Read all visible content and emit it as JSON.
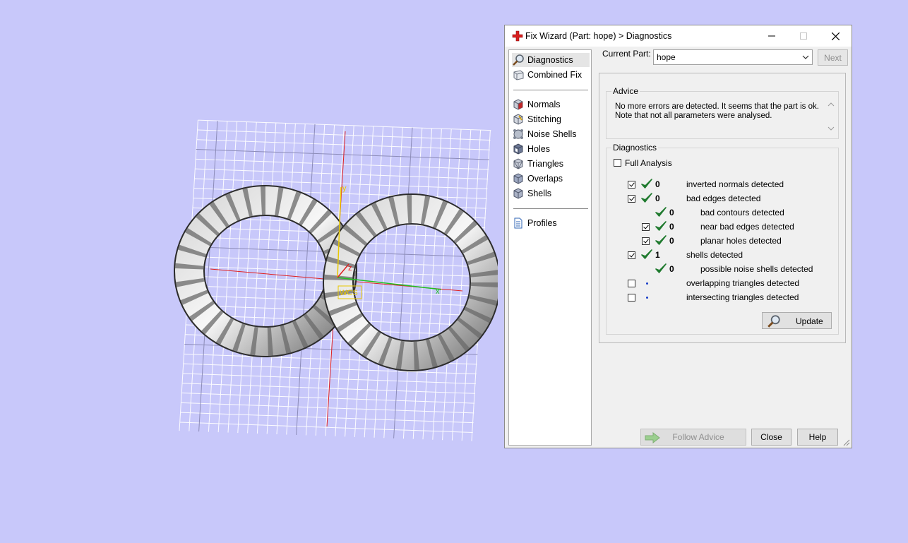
{
  "viewport": {
    "axis_labels": {
      "x": "x",
      "y": "y",
      "z": "z"
    },
    "wcs_label": "WCS"
  },
  "window": {
    "title": "Fix Wizard (Part: hope) > Diagnostics",
    "controls": {
      "minimize": "minimize",
      "maximize": "maximize",
      "close": "close"
    }
  },
  "nav": {
    "items": [
      {
        "label": "Diagnostics",
        "icon": "magnifier-icon",
        "selected": true
      },
      {
        "label": "Combined Fix",
        "icon": "combined-fix-icon"
      },
      {
        "label": "Normals",
        "icon": "normals-cube-icon"
      },
      {
        "label": "Stitching",
        "icon": "stitching-cube-icon"
      },
      {
        "label": "Noise Shells",
        "icon": "noise-shells-icon"
      },
      {
        "label": "Holes",
        "icon": "holes-cube-icon"
      },
      {
        "label": "Triangles",
        "icon": "triangles-cube-icon"
      },
      {
        "label": "Overlaps",
        "icon": "overlaps-cube-icon"
      },
      {
        "label": "Shells",
        "icon": "shells-cube-icon"
      },
      {
        "label": "Profiles",
        "icon": "profiles-document-icon"
      }
    ]
  },
  "toolbar": {
    "current_part_label": "Current Part:",
    "current_part_value": "hope",
    "next_label": "Next"
  },
  "advice": {
    "title": "Advice",
    "line1": "No more errors are detected. It seems that the part is ok.",
    "line2": "Note that not all parameters were analysed."
  },
  "diagnostics": {
    "title": "Diagnostics",
    "full_analysis_label": "Full Analysis",
    "full_analysis_checked": false,
    "rows": [
      {
        "checkbox": true,
        "checked": true,
        "status": "ok",
        "count": "0",
        "label": "inverted normals detected",
        "indent": 0
      },
      {
        "checkbox": true,
        "checked": true,
        "status": "ok",
        "count": "0",
        "label": "bad edges detected",
        "indent": 0
      },
      {
        "checkbox": false,
        "checked": false,
        "status": "ok",
        "count": "0",
        "label": "bad contours detected",
        "indent": 1
      },
      {
        "checkbox": true,
        "checked": true,
        "status": "ok",
        "count": "0",
        "label": "near bad edges detected",
        "indent": 1
      },
      {
        "checkbox": true,
        "checked": true,
        "status": "ok",
        "count": "0",
        "label": "planar holes detected",
        "indent": 1
      },
      {
        "checkbox": true,
        "checked": true,
        "status": "ok",
        "count": "1",
        "label": "shells detected",
        "indent": 0
      },
      {
        "checkbox": false,
        "checked": false,
        "status": "ok",
        "count": "0",
        "label": "possible noise shells detected",
        "indent": 1
      },
      {
        "checkbox": true,
        "checked": false,
        "status": "pending",
        "count": "",
        "label": "overlapping triangles detected",
        "indent": 0
      },
      {
        "checkbox": true,
        "checked": false,
        "status": "pending",
        "count": "",
        "label": "intersecting triangles detected",
        "indent": 0
      }
    ],
    "update_label": "Update"
  },
  "footer": {
    "follow_advice_label": "Follow Advice",
    "close_label": "Close",
    "help_label": "Help"
  },
  "colors": {
    "background": "#c8c8fa",
    "ok_check": "#1f7a2e",
    "pending_dot": "#1a3fc8",
    "axis_x": "#e02020",
    "axis_y": "#e8c800",
    "axis_green": "#20c020"
  }
}
